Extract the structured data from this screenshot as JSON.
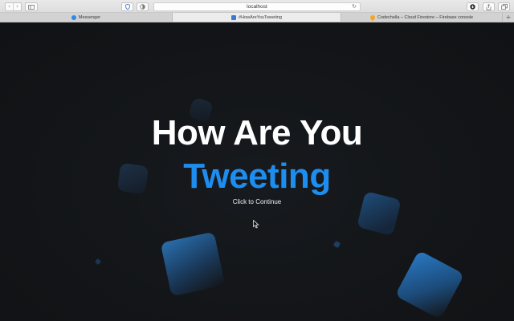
{
  "browser": {
    "url": "localhost",
    "tabs": [
      {
        "label": "Messenger",
        "icon": "messenger-icon",
        "active": false
      },
      {
        "label": "#HowAreYouTweeting",
        "icon": "site-icon",
        "active": true
      },
      {
        "label": "Codechella – Cloud Firestore – Firebase console",
        "icon": "firebase-icon",
        "active": false
      }
    ],
    "icons": {
      "back": "back-arrow-icon",
      "forward": "forward-arrow-icon",
      "sidebar": "sidebar-icon",
      "shield": "shield-icon",
      "reader": "reader-icon",
      "reload": "reload-icon",
      "download": "download-icon",
      "share": "share-icon",
      "tabs": "tab-overview-icon",
      "new_tab": "new-tab-icon"
    }
  },
  "hero": {
    "title_line1": "How Are You",
    "title_line2": "Tweeting",
    "cta": "Click to Continue"
  },
  "colors": {
    "background": "#131518",
    "accent": "#1d8ef0",
    "title": "#ffffff"
  }
}
